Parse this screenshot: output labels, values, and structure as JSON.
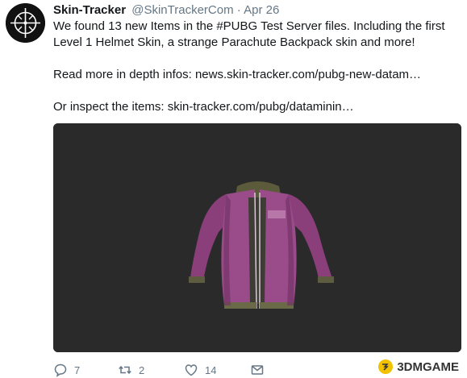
{
  "tweet": {
    "display_name": "Skin-Tracker",
    "handle": "@SkinTrackerCom",
    "separator": "·",
    "date": "Apr 26",
    "text_line1": "We found 13 new Items in the #PUBG Test Server files. Including the first Level 1 Helmet Skin, a strange Parachute Backpack skin and more!",
    "text_line2_prefix": "Read more in depth infos: ",
    "text_line2_link": "news.skin-tracker.com/pubg-new-datam…",
    "text_line3_prefix": "Or inspect the items: ",
    "text_line3_link": "skin-tracker.com/pubg/dataminin…",
    "media_alt": "pink bomber jacket skin on dark background"
  },
  "actions": {
    "reply_count": "7",
    "retweet_count": "2",
    "like_count": "14",
    "icons": [
      "reply-icon",
      "retweet-icon",
      "like-icon",
      "message-icon"
    ]
  },
  "watermark": {
    "text": "3DMGAME"
  },
  "colors": {
    "text": "#14171a",
    "muted": "#657786",
    "media_bg": "#2a2a2a",
    "jacket": "#9a4b8a"
  }
}
